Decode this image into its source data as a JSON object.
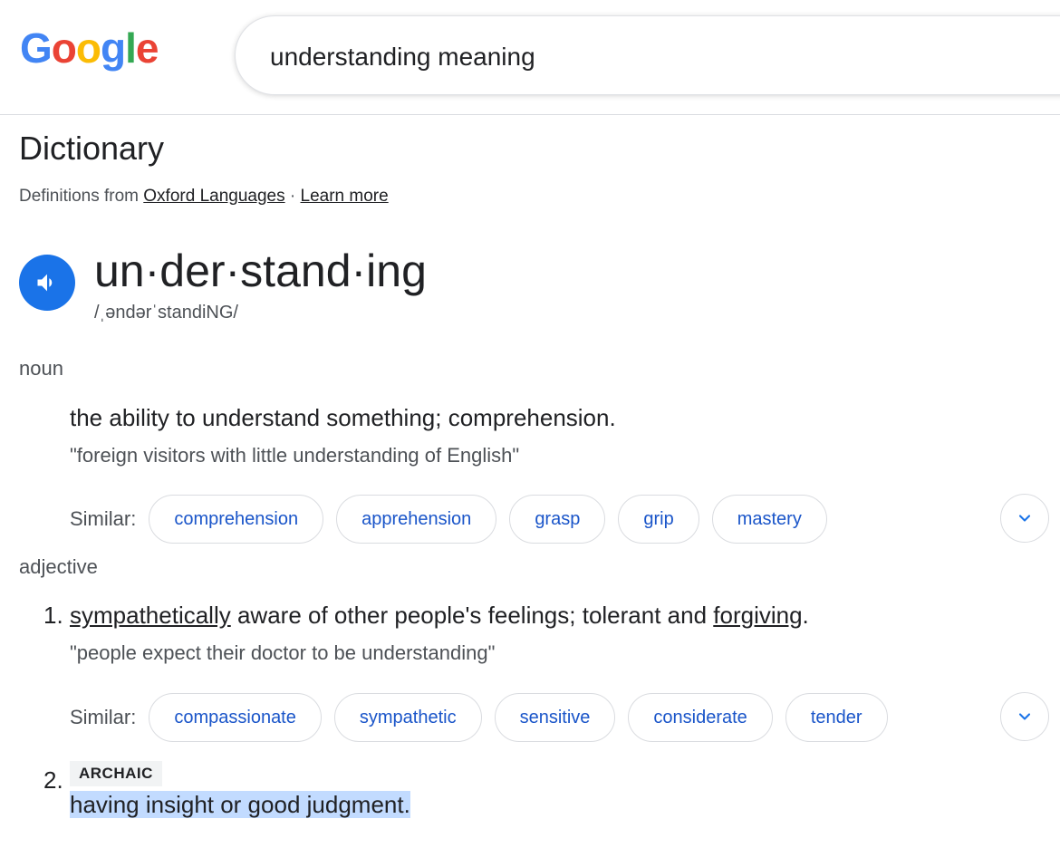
{
  "logo": {
    "text": "Google"
  },
  "search": {
    "query": "understanding meaning"
  },
  "dictionary": {
    "title": "Dictionary",
    "source_prefix": "Definitions from",
    "source_link": "Oxford Languages",
    "separator": "·",
    "learn_more": "Learn more"
  },
  "entry": {
    "headword": "un·der·stand·ing",
    "phonetic": "/ˌəndərˈstandiNG/",
    "noun": {
      "pos": "noun",
      "definition": "the ability to understand something; comprehension.",
      "example": "\"foreign visitors with little understanding of English\"",
      "similar_label": "Similar:",
      "similar": [
        "comprehension",
        "apprehension",
        "grasp",
        "grip",
        "mastery"
      ]
    },
    "adjective": {
      "pos": "adjective",
      "sense1": {
        "number": "1.",
        "link1": "sympathetically",
        "middle": " aware of other people's feelings; tolerant and ",
        "link2": "forgiving",
        "end": ".",
        "example": "\"people expect their doctor to be understanding\"",
        "similar_label": "Similar:",
        "similar": [
          "compassionate",
          "sympathetic",
          "sensitive",
          "considerate",
          "tender"
        ]
      },
      "sense2": {
        "number": "2.",
        "tag": "ARCHAIC",
        "definition": "having insight or good judgment."
      }
    }
  },
  "icons": {
    "speaker": "speaker-icon",
    "expand": "chevron-down-icon"
  },
  "colors": {
    "accent": "#1a73e8",
    "chip_text": "#1a55c9",
    "highlight": "#c2dbff"
  }
}
